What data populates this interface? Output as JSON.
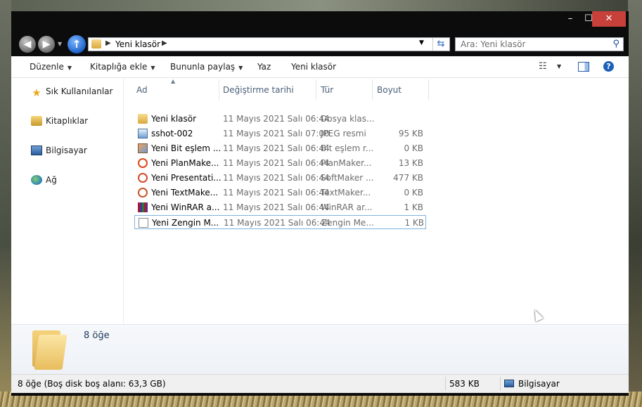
{
  "window": {
    "min_glyph": "–",
    "max_glyph": "☐",
    "close_glyph": "✕"
  },
  "nav": {
    "address_path": "Yeni klasör",
    "search_placeholder": "Ara: Yeni klasör"
  },
  "toolbar": {
    "organize": "Düzenle",
    "add_to_library": "Kitaplığa ekle",
    "share_with": "Bununla paylaş",
    "burn": "Yaz",
    "new_folder": "Yeni klasör"
  },
  "sidebar": {
    "items": [
      {
        "label": "Sık Kullanılanlar",
        "icon": "star-icon"
      },
      {
        "label": "Kitaplıklar",
        "icon": "library-icon"
      },
      {
        "label": "Bilgisayar",
        "icon": "computer-icon"
      },
      {
        "label": "Ağ",
        "icon": "network-icon"
      }
    ]
  },
  "columns": {
    "name": "Ad",
    "date": "Değiştirme tarihi",
    "type": "Tür",
    "size": "Boyut"
  },
  "files": [
    {
      "name": "Yeni klasör",
      "date": "11 Mayıs 2021 Salı 06:44",
      "type": "Dosya klas...",
      "size": "",
      "icon": "folder-icon"
    },
    {
      "name": "sshot-002",
      "date": "11 Mayıs 2021 Salı 07:00",
      "type": "JPEG resmi",
      "size": "95 KB",
      "icon": "jpeg-icon"
    },
    {
      "name": "Yeni Bit eşlem ...",
      "date": "11 Mayıs 2021 Salı 06:44",
      "type": "Bit eşlem r...",
      "size": "0 KB",
      "icon": "bitmap-icon"
    },
    {
      "name": "Yeni PlanMake...",
      "date": "11 Mayıs 2021 Salı 06:44",
      "type": "PlanMaker...",
      "size": "13 KB",
      "icon": "planmaker-icon"
    },
    {
      "name": "Yeni Presentati...",
      "date": "11 Mayıs 2021 Salı 06:44",
      "type": "SoftMaker ...",
      "size": "477 KB",
      "icon": "presentations-icon"
    },
    {
      "name": "Yeni TextMake...",
      "date": "11 Mayıs 2021 Salı 06:44",
      "type": "TextMaker...",
      "size": "0 KB",
      "icon": "textmaker-icon"
    },
    {
      "name": "Yeni WinRAR a...",
      "date": "11 Mayıs 2021 Salı 06:44",
      "type": "WinRAR ar...",
      "size": "1 KB",
      "icon": "winrar-icon"
    },
    {
      "name": "Yeni Zengin M...",
      "date": "11 Mayıs 2021 Salı 06:44",
      "type": "Zengin Me...",
      "size": "1 KB",
      "icon": "rtf-document-icon"
    }
  ],
  "details": {
    "item_count": "8 öğe"
  },
  "status": {
    "summary": "8 öğe (Boş disk boş alanı: 63,3 GB)",
    "total_size": "583 KB",
    "location": "Bilgisayar"
  }
}
